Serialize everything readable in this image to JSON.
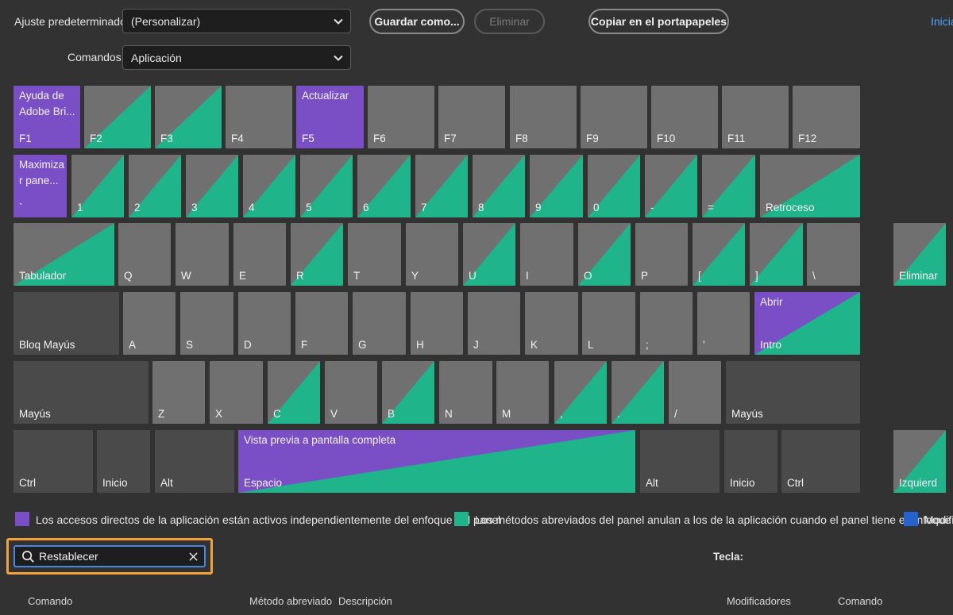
{
  "header": {
    "preset_label": "Ajuste predeterminado:",
    "preset_value": "(Personalizar)",
    "commands_label": "Comandos:",
    "commands_value": "Aplicación",
    "save_as_button": "Guardar como...",
    "delete_button": "Eliminar",
    "copy_button": "Copiar en el portapapeles",
    "start_link": "Inicia"
  },
  "colors": {
    "key_gray": "#707070",
    "key_dark": "#4a4a4a",
    "app_purple": "#7a4fc6",
    "panel_green": "#1fb489",
    "modifier_blue": "#2463c9"
  },
  "keyboard": {
    "f1": {
      "label": "F1",
      "command": "Ayuda de Adobe Bri..."
    },
    "f2": "F2",
    "f3": "F3",
    "f4": "F4",
    "f5": {
      "label": "F5",
      "command": "Actualizar"
    },
    "f6": "F6",
    "f7": "F7",
    "f8": "F8",
    "f9": "F9",
    "f10": "F10",
    "f11": "F11",
    "f12": "F12",
    "backtick": {
      "label": "`",
      "command": "Maximizar pane..."
    },
    "k1": "1",
    "k2": "2",
    "k3": "3",
    "k4": "4",
    "k5": "5",
    "k6": "6",
    "k7": "7",
    "k8": "8",
    "k9": "9",
    "k0": "0",
    "minus": "-",
    "equals": "=",
    "backspace": "Retroceso",
    "tab": "Tabulador",
    "q": "Q",
    "w": "W",
    "e": "E",
    "r": "R",
    "t": "T",
    "y": "Y",
    "u": "U",
    "i": "I",
    "o": "O",
    "p": "P",
    "lbracket": "[",
    "rbracket": "]",
    "backslash": "\\",
    "delete": "Eliminar",
    "capslock": "Bloq Mayús",
    "a": "A",
    "s": "S",
    "d": "D",
    "f": "F",
    "g": "G",
    "h": "H",
    "j": "J",
    "k": "K",
    "l": "L",
    "semicolon": ";",
    "quote": "'",
    "enter": {
      "label": "Intro",
      "command": "Abrir"
    },
    "shift_left": "Mayús",
    "z": "Z",
    "x": "X",
    "c": "C",
    "v": "V",
    "b": "B",
    "n": "N",
    "m": "M",
    "comma": ",",
    "period": ".",
    "slash": "/",
    "shift_right": "Mayús",
    "ctrl_left": "Ctrl",
    "home_left": "Inicio",
    "alt_left": "Alt",
    "space": {
      "label": "Espacio",
      "command": "Vista previa a pantalla completa"
    },
    "alt_right": "Alt",
    "home_right": "Inicio",
    "ctrl_right": "Ctrl",
    "left_arrow": "Izquierd"
  },
  "legend": {
    "app": "Los accesos directos de la aplicación están activos independientemente del enfoque del panel",
    "panel": "Los métodos abreviados del panel anulan a los de la aplicación cuando el panel tiene el enfoque",
    "modifier": "Modific"
  },
  "search": {
    "value": "Restablecer"
  },
  "key_label": "Tecla:",
  "table_left": {
    "col_command": "Comando",
    "col_shortcut": "Método abreviado",
    "col_description": "Descripción"
  },
  "table_right": {
    "col_modifiers": "Modificadores",
    "col_command": "Comando"
  }
}
